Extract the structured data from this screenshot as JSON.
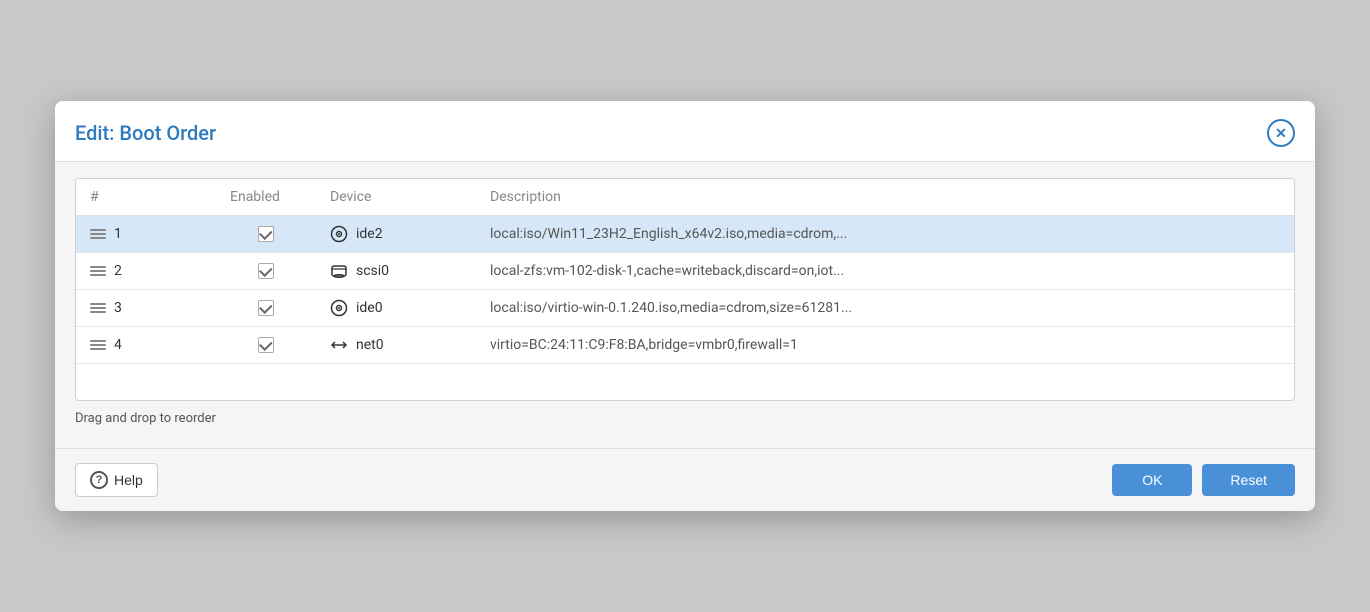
{
  "dialog": {
    "title": "Edit: Boot Order",
    "drag_hint": "Drag and drop to reorder"
  },
  "table": {
    "headers": {
      "num": "#",
      "enabled": "Enabled",
      "device": "Device",
      "description": "Description"
    },
    "rows": [
      {
        "num": 1,
        "enabled": true,
        "device_icon": "cdrom",
        "device_name": "ide2",
        "description": "local:iso/Win11_23H2_English_x64v2.iso,media=cdrom,...",
        "selected": true
      },
      {
        "num": 2,
        "enabled": true,
        "device_icon": "disk",
        "device_name": "scsi0",
        "description": "local-zfs:vm-102-disk-1,cache=writeback,discard=on,iot...",
        "selected": false
      },
      {
        "num": 3,
        "enabled": true,
        "device_icon": "cdrom",
        "device_name": "ide0",
        "description": "local:iso/virtio-win-0.1.240.iso,media=cdrom,size=61281...",
        "selected": false
      },
      {
        "num": 4,
        "enabled": true,
        "device_icon": "net",
        "device_name": "net0",
        "description": "virtio=BC:24:11:C9:F8:BA,bridge=vmbr0,firewall=1",
        "selected": false
      }
    ]
  },
  "buttons": {
    "help": "Help",
    "ok": "OK",
    "reset": "Reset"
  }
}
